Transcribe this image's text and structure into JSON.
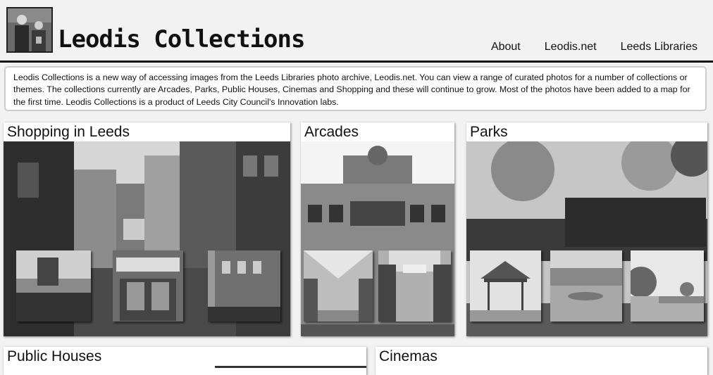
{
  "header": {
    "brand": "Leodis Collections",
    "nav": [
      "About",
      "Leodis.net",
      "Leeds Libraries"
    ]
  },
  "intro": {
    "text": "Leodis Collections is a new way of accessing images from the Leeds Libraries photo archive, Leodis.net. You can view a range of curated photos for a number of collections or themes. The collections currently are Arcades, Parks, Public Houses, Cinemas and Shopping and these will continue to grow. Most of the photos have been added to a map for the first time. Leodis Collections is a product of Leeds City Council's Innovation labs."
  },
  "collections": [
    {
      "title": "Shopping in Leeds"
    },
    {
      "title": "Arcades"
    },
    {
      "title": "Parks"
    },
    {
      "title": "Public Houses"
    },
    {
      "title": "Cinemas"
    }
  ]
}
